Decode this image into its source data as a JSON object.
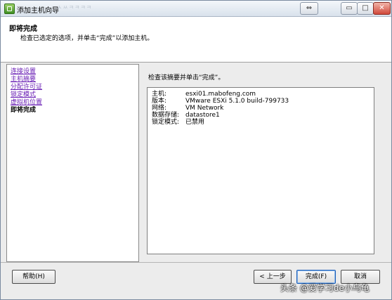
{
  "window": {
    "title": "添加主机向导",
    "ghost_text": "ㅅㅆㅋㅋㅋㅋ"
  },
  "header": {
    "title": "即将完成",
    "subtitle": "检查已选定的选项，并单击“完成”以添加主机。"
  },
  "nav": {
    "items": [
      {
        "label": "连接设置",
        "current": false
      },
      {
        "label": "主机摘要",
        "current": false
      },
      {
        "label": "分配许可证",
        "current": false
      },
      {
        "label": "锁定模式",
        "current": false
      },
      {
        "label": "虚拟机位置",
        "current": false
      },
      {
        "label": "即将完成",
        "current": true
      }
    ]
  },
  "content": {
    "prompt": "检查该摘要并单击“完成”。",
    "summary": [
      {
        "key": "主机:",
        "value": "esxi01.mabofeng.com"
      },
      {
        "key": "版本:",
        "value": "VMware ESXi 5.1.0 build-799733"
      },
      {
        "key": "网络:",
        "value": "VM Network"
      },
      {
        "key": "数据存储:",
        "value": "datastore1"
      },
      {
        "key": "锁定模式:",
        "value": "已禁用"
      }
    ]
  },
  "footer": {
    "help": "帮助(H)",
    "back": "< 上一步",
    "finish": "完成(F)",
    "cancel": "取消"
  },
  "watermark": "头条 @爱学习de小乌龟",
  "titlebar_buttons": {
    "swap": "⇔",
    "minimize": "▭",
    "maximize": "□",
    "close": "✕"
  }
}
